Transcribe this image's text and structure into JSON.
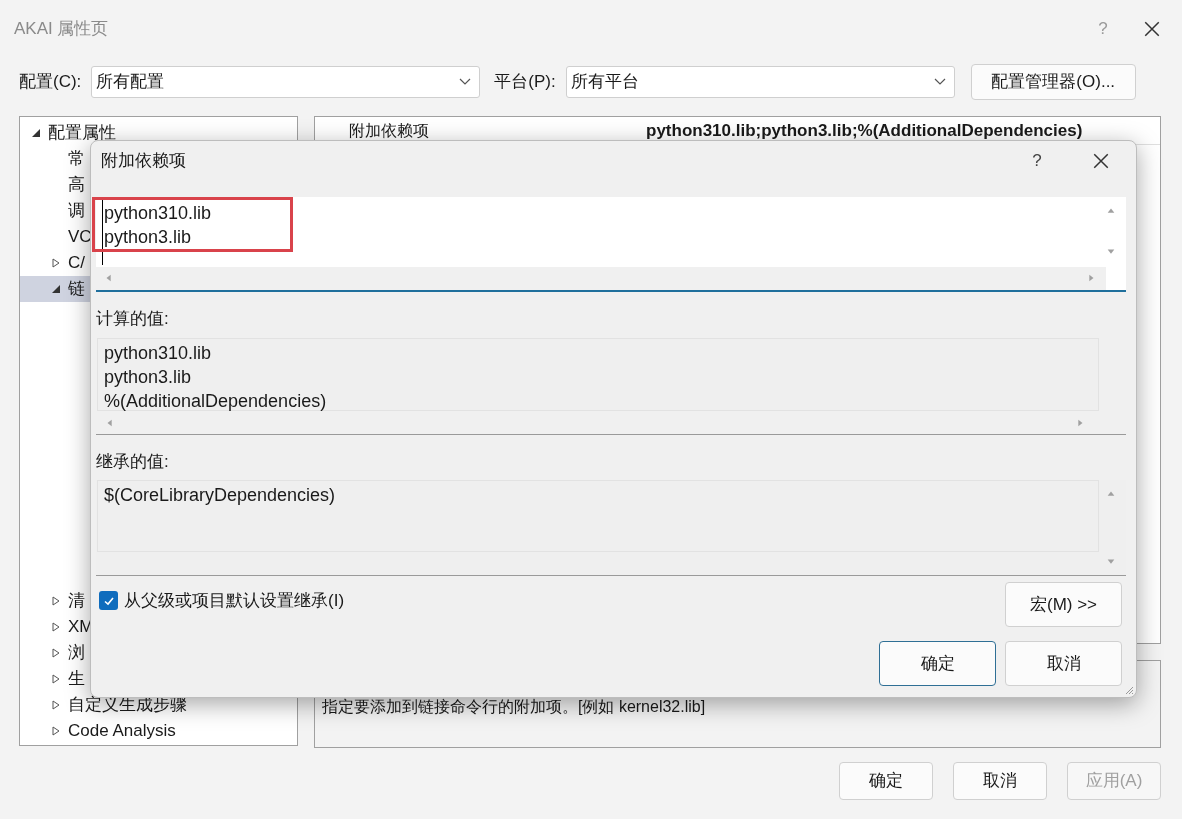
{
  "window": {
    "title": "AKAI 属性页",
    "help": "?"
  },
  "toolbar": {
    "config_label": "配置(C):",
    "config_value": "所有配置",
    "platform_label": "平台(P):",
    "platform_value": "所有平台",
    "manager_button": "配置管理器(O)..."
  },
  "tree": [
    {
      "label": "配置属性",
      "expanded": true,
      "selected": false,
      "children": [
        {
          "label": "常",
          "selected": false
        },
        {
          "label": "高",
          "selected": false
        },
        {
          "label": "调",
          "selected": false
        },
        {
          "label": "VC",
          "selected": false
        },
        {
          "label": "C/",
          "expanded": false,
          "selected": false
        },
        {
          "label": "链",
          "expanded": true,
          "selected": true
        },
        {
          "label": "清",
          "expanded": false,
          "selected": false
        },
        {
          "label": "XM",
          "expanded": false,
          "selected": false
        },
        {
          "label": "浏",
          "expanded": false,
          "selected": false
        },
        {
          "label": "生",
          "expanded": false,
          "selected": false
        },
        {
          "label": "自定义生成步骤",
          "expanded": false,
          "selected": false
        },
        {
          "label": "Code Analysis",
          "expanded": false,
          "selected": false
        }
      ]
    }
  ],
  "property_grid": {
    "rows": [
      {
        "name": "附加依赖项",
        "value": "python310.lib;python3.lib;%(AdditionalDependencies)"
      }
    ]
  },
  "description": "指定要添加到链接命令行的附加项。[例如 kernel32.lib]",
  "footer_buttons": [
    {
      "label": "确定",
      "disabled": false
    },
    {
      "label": "取消",
      "disabled": false
    },
    {
      "label": "应用(A)",
      "disabled": true
    }
  ],
  "dialog": {
    "title": "附加依赖项",
    "help": "?",
    "value_lines": [
      "python310.lib",
      "python3.lib"
    ],
    "evaluated_label": "计算的值:",
    "evaluated_lines": [
      "python310.lib",
      "python3.lib",
      "%(AdditionalDependencies)"
    ],
    "inherited_label": "继承的值:",
    "inherited_lines": [
      "$(CoreLibraryDependencies)"
    ],
    "inherit_checkbox": {
      "label": "从父级或项目默认设置继承(I)",
      "checked": true
    },
    "macro_button": "宏(M) >>",
    "ok_button": "确定",
    "cancel_button": "取消"
  }
}
